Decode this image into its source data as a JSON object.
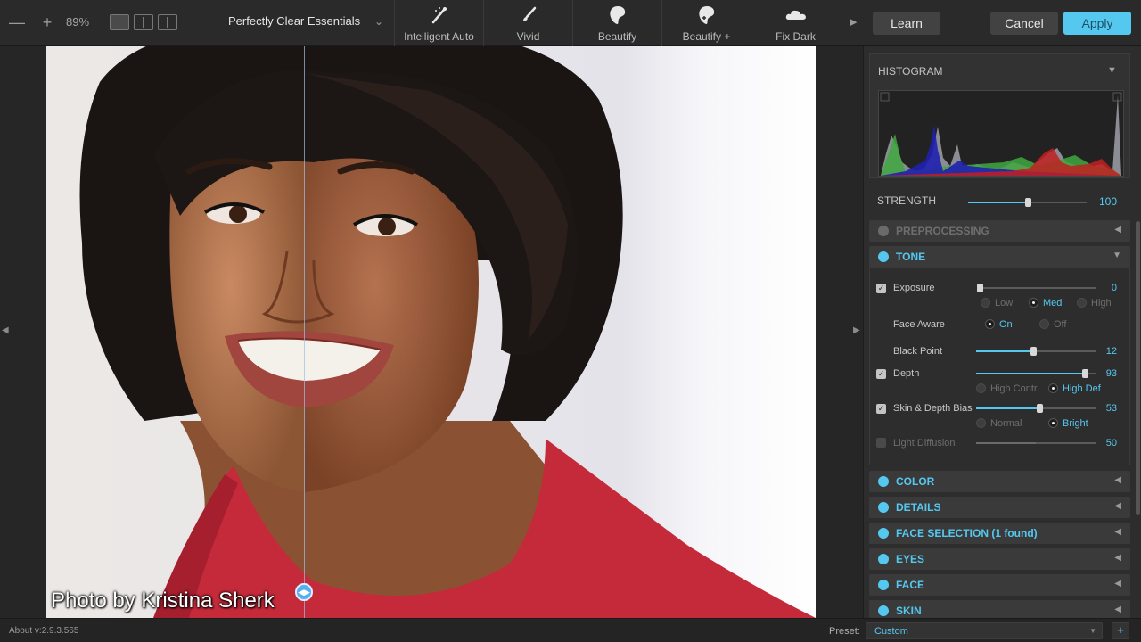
{
  "toolbar": {
    "zoom_out": "—",
    "zoom_in": "+",
    "zoom_level": "89%",
    "preset_name": "Perfectly Clear Essentials",
    "quick_presets": [
      {
        "label": "Intelligent Auto",
        "icon": "magic-wand-icon"
      },
      {
        "label": "Vivid",
        "icon": "brush-icon"
      },
      {
        "label": "Beautify",
        "icon": "face-icon"
      },
      {
        "label": "Beautify +",
        "icon": "face-plus-icon"
      },
      {
        "label": "Fix Dark",
        "icon": "cloud-icon"
      }
    ],
    "learn_label": "Learn",
    "cancel_label": "Cancel",
    "apply_label": "Apply"
  },
  "photo": {
    "credit": "Photo by Kristina Sherk",
    "split_position": 0.335
  },
  "panel": {
    "histogram_title": "HISTOGRAM",
    "strength_label": "STRENGTH",
    "strength_value": "100",
    "strength_level": 0.5,
    "sections": [
      {
        "title": "PREPROCESSING",
        "enabled": false
      },
      {
        "title": "TONE",
        "enabled": true,
        "expanded": true
      },
      {
        "title": "COLOR",
        "enabled": true
      },
      {
        "title": "DETAILS",
        "enabled": true
      },
      {
        "title": "FACE SELECTION (1 found)",
        "enabled": true
      },
      {
        "title": "EYES",
        "enabled": true
      },
      {
        "title": "FACE",
        "enabled": true
      },
      {
        "title": "SKIN",
        "enabled": true
      }
    ],
    "tone": {
      "exposure": {
        "label": "Exposure",
        "value": "0",
        "level": 0.0,
        "checked": true,
        "options": [
          "Low",
          "Med",
          "High"
        ],
        "selected": "Med"
      },
      "face_aware": {
        "label": "Face Aware",
        "options": [
          "On",
          "Off"
        ],
        "selected": "On"
      },
      "black_point": {
        "label": "Black Point",
        "value": "12",
        "level": 0.48
      },
      "depth": {
        "label": "Depth",
        "value": "93",
        "level": 0.91,
        "checked": true,
        "options": [
          "High Contr",
          "High Def"
        ],
        "selected": "High Def"
      },
      "skin_depth_bias": {
        "label": "Skin & Depth Bias",
        "value": "53",
        "level": 0.53,
        "checked": true,
        "options": [
          "Normal",
          "Bright"
        ],
        "selected": "Bright"
      },
      "light_diffusion": {
        "label": "Light Diffusion",
        "value": "50",
        "level": 0.5,
        "checked": false
      }
    }
  },
  "statusbar": {
    "version": "About v:2.9.3.565",
    "preset_label": "Preset:",
    "preset_value": "Custom",
    "add_label": "+"
  },
  "colors": {
    "accent": "#55c8f0",
    "panel_bg": "#2d2d2d",
    "toolbar_bg": "#2a2a2a"
  }
}
